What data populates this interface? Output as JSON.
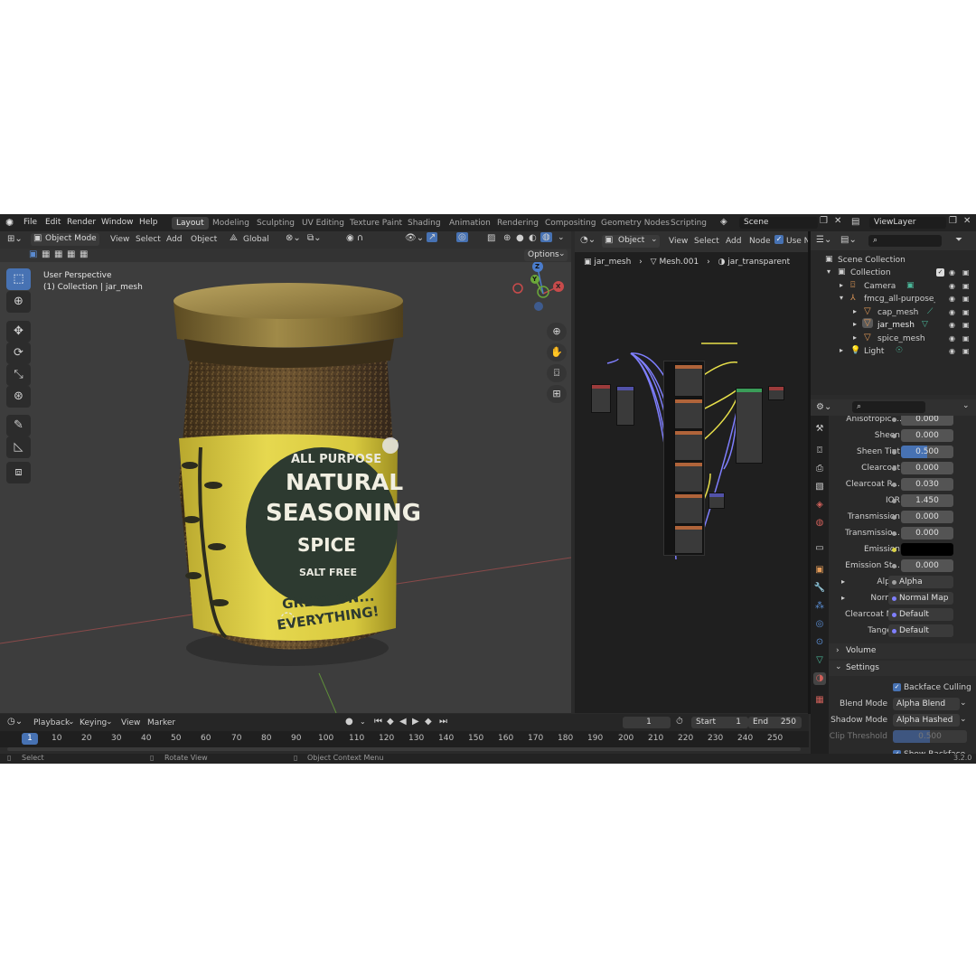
{
  "menu": [
    "File",
    "Edit",
    "Render",
    "Window",
    "Help"
  ],
  "workspaces": [
    {
      "label": "Layout",
      "active": true
    },
    {
      "label": "Modeling"
    },
    {
      "label": "Sculpting"
    },
    {
      "label": "UV Editing"
    },
    {
      "label": "Texture Paint"
    },
    {
      "label": "Shading"
    },
    {
      "label": "Animation"
    },
    {
      "label": "Rendering"
    },
    {
      "label": "Compositing"
    },
    {
      "label": "Geometry Nodes"
    },
    {
      "label": "Scripting"
    }
  ],
  "scene": {
    "name": "Scene",
    "view_layer": "ViewLayer"
  },
  "viewport_header": {
    "mode": "Object Mode",
    "menus": [
      "View",
      "Select",
      "Add",
      "Object"
    ],
    "transform": "Global",
    "options": "Options"
  },
  "viewport": {
    "line1": "User Perspective",
    "line2": "(1) Collection | jar_mesh"
  },
  "gizmo": {
    "x": "X",
    "y": "Y",
    "z": "Z"
  },
  "label_art": {
    "l1": "ALL PURPOSE",
    "l2": "NATURAL",
    "l3": "SEASONING",
    "l4": "SPICE",
    "l5": "SALT FREE",
    "l6": "GREAT ON...",
    "l7": "EVERYTHING!"
  },
  "node_header": {
    "object": "Object",
    "menus": [
      "View",
      "Select",
      "Add",
      "Node"
    ],
    "use_nodes": "Use No"
  },
  "breadcrumb": {
    "a": "jar_mesh",
    "b": "Mesh.001",
    "c": "jar_transparent"
  },
  "outliner": {
    "root": "Scene Collection",
    "items": [
      {
        "label": "Collection",
        "indent": 1,
        "color": "#cfcfcf"
      },
      {
        "label": "Camera",
        "indent": 2
      },
      {
        "label": "fmcg_all-purpose_se",
        "indent": 2
      },
      {
        "label": "cap_mesh",
        "indent": 3
      },
      {
        "label": "jar_mesh",
        "indent": 3
      },
      {
        "label": "spice_mesh",
        "indent": 3
      },
      {
        "label": "Light",
        "indent": 2
      }
    ]
  },
  "properties": [
    {
      "label": "Anisotropic ...",
      "value": "0.000"
    },
    {
      "label": "Sheen",
      "value": "0.000"
    },
    {
      "label": "Sheen Tint",
      "value": "0.500",
      "highlight": true
    },
    {
      "label": "Clearcoat",
      "value": "0.000"
    },
    {
      "label": "Clearcoat R...",
      "value": "0.030"
    },
    {
      "label": "IOR",
      "value": "1.450"
    },
    {
      "label": "Transmission",
      "value": "0.000"
    },
    {
      "label": "Transmissio...",
      "value": "0.000"
    },
    {
      "label": "Emission",
      "value": ""
    },
    {
      "label": "Emission St...",
      "value": "0.000"
    },
    {
      "label": "Alpha",
      "value": "Alpha",
      "link": true
    },
    {
      "label": "Normal",
      "value": "Normal Map",
      "link": true
    },
    {
      "label": "Clearcoat N...",
      "value": "Default",
      "link": true
    },
    {
      "label": "Tangent",
      "value": "Default",
      "link": true
    }
  ],
  "panels": {
    "volume": "Volume",
    "settings": "Settings"
  },
  "settings": {
    "backface": "Backface Culling",
    "blend_label": "Blend Mode",
    "blend_value": "Alpha Blend",
    "shadow_label": "Shadow Mode",
    "shadow_value": "Alpha Hashed",
    "clip_label": "Clip Threshold",
    "clip_value": "0.500",
    "show_backface": "Show Backface"
  },
  "timeline": {
    "menus": [
      "Playback",
      "Keying",
      "View",
      "Marker"
    ],
    "current": "1",
    "start_label": "Start",
    "start": "1",
    "end_label": "End",
    "end": "250"
  },
  "ruler_ticks": [
    "1",
    "10",
    "20",
    "30",
    "40",
    "50",
    "60",
    "70",
    "80",
    "90",
    "100",
    "110",
    "120",
    "130",
    "140",
    "150",
    "160",
    "170",
    "180",
    "190",
    "200",
    "210",
    "220",
    "230",
    "240",
    "250"
  ],
  "status": {
    "select": "Select",
    "rotate": "Rotate View",
    "context": "Object Context Menu",
    "version": "3.2.0"
  },
  "colors": {
    "accent": "#4772b3",
    "label_yellow": "#e2d44a",
    "label_dark": "#2d3a30",
    "cap": "#8f7a3c"
  }
}
